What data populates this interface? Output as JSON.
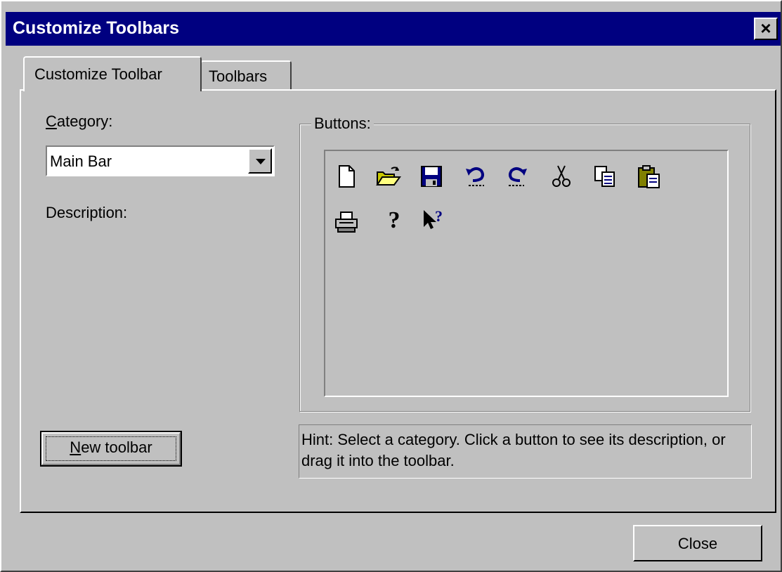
{
  "window": {
    "title": "Customize Toolbars",
    "close_glyph": "✕"
  },
  "tabs": [
    {
      "label": "Customize Toolbar",
      "active": true
    },
    {
      "label": "Toolbars",
      "active": false
    }
  ],
  "category": {
    "label_mnemonic": "C",
    "label_rest": "ategory:",
    "selected": "Main Bar"
  },
  "description": {
    "label": "Description:"
  },
  "buttons_group": {
    "label": "Buttons:",
    "icons": [
      "new-document-icon",
      "open-folder-icon",
      "save-disk-icon",
      "undo-icon",
      "redo-icon",
      "cut-scissors-icon",
      "copy-icon",
      "paste-clipboard-icon",
      "print-icon",
      "help-question-icon",
      "context-help-icon"
    ]
  },
  "hint": {
    "text": "Hint: Select a category. Click a button to see its description, or drag it into the toolbar."
  },
  "new_toolbar_button": {
    "mnemonic": "N",
    "rest": "ew toolbar"
  },
  "close_button": {
    "label": "Close"
  },
  "colors": {
    "face": "#c0c0c0",
    "titlebar": "#000080",
    "icon_navy": "#000080",
    "icon_yellow": "#c8c800"
  }
}
